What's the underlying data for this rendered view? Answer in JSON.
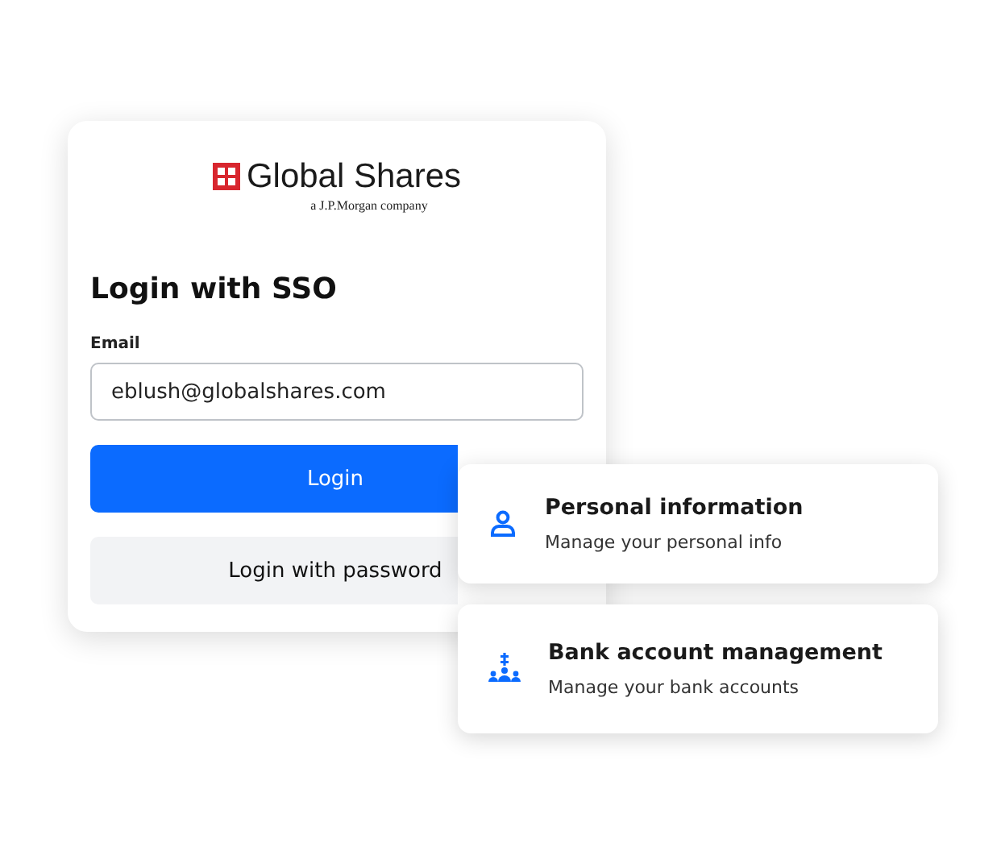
{
  "logo": {
    "name": "Global Shares",
    "tagline": "a J.P.Morgan company"
  },
  "login": {
    "title": "Login with SSO",
    "email_label": "Email",
    "email_value": "eblush@globalshares.com",
    "primary_button": "Login",
    "secondary_button": "Login with password"
  },
  "cards": [
    {
      "kind": "person",
      "title": "Personal information",
      "subtitle": "Manage your personal info"
    },
    {
      "kind": "bank",
      "title": "Bank account management",
      "subtitle": "Manage your bank accounts"
    }
  ]
}
